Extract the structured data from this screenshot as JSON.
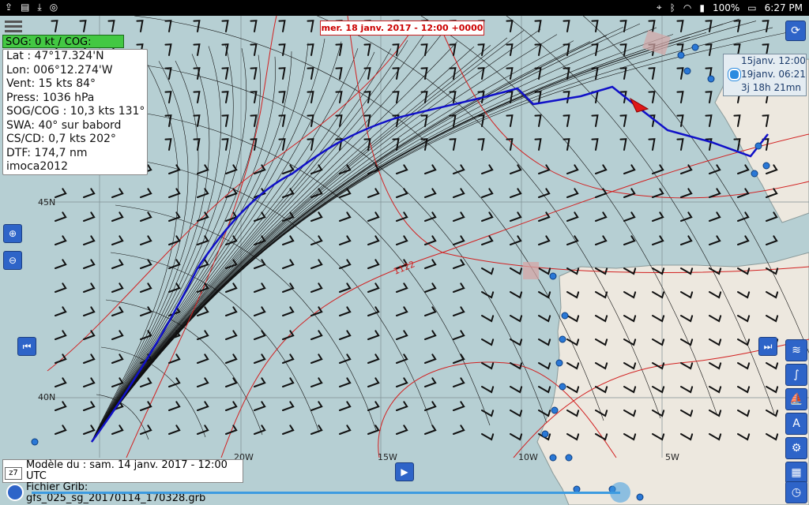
{
  "status_bar": {
    "time": "6:27 PM",
    "battery": "100%",
    "left_icons": [
      "upload-icon",
      "notes-app-icon",
      "download-icon",
      "compass-icon"
    ],
    "right_icons": [
      "location-icon",
      "bluetooth-icon",
      "wifi-icon",
      "signal-icon",
      "battery-icon"
    ]
  },
  "header": {
    "date_label": "mer. 18 janv. 2017 - 12:00 +0000"
  },
  "boat": {
    "sog_bar": "SOG: 0 kt / COG:"
  },
  "info_panel": {
    "lines": [
      "Lat :  47°17.324'N",
      "Lon: 006°12.274'W",
      "Vent:  15 kts  84°",
      "Press: 1036 hPa",
      "SOG/COG : 10,3 kts 131°",
      "SWA: 40° sur babord",
      "CS/CD: 0,7 kts 202°",
      "DTF: 174,7 nm",
      "imoca2012"
    ]
  },
  "eta_panel": {
    "start": "15janv. 12:00",
    "arrival": "19janv. 06:21",
    "duration": "3j 18h 21mn"
  },
  "map_labels": {
    "lat_45": "45N",
    "lat_40": "40N",
    "lon_20": "20W",
    "lon_15": "15W",
    "lon_10": "10W",
    "lon_5": "5W",
    "isobar": "1122"
  },
  "footer": {
    "model_line": "Modèle du : sam. 14 janv. 2017 - 12:00 UTC",
    "grib_line": "Fichier Grib: gfs_025_sg_20170114_170328.grb",
    "zoom_level": "z7"
  },
  "controls": {
    "zoom_in": "zoom-in-icon",
    "zoom_out": "zoom-out-icon",
    "prev": "skip-back-icon",
    "next": "skip-forward-icon",
    "play": "play-icon",
    "right_tools": [
      "wind-layer-icon",
      "route-curve-icon",
      "sailboat-icon",
      "compass-tool-icon",
      "settings-icon",
      "grid-table-icon",
      "clock-icon"
    ],
    "refresh": "refresh-icon"
  },
  "colors": {
    "route": "#1010c8",
    "isochrone": "#111111",
    "isobar": "#d22020",
    "sog_bar": "#43c843",
    "button": "#2e64c8",
    "land": "#ede8df",
    "sea": "#b6cfd3"
  }
}
